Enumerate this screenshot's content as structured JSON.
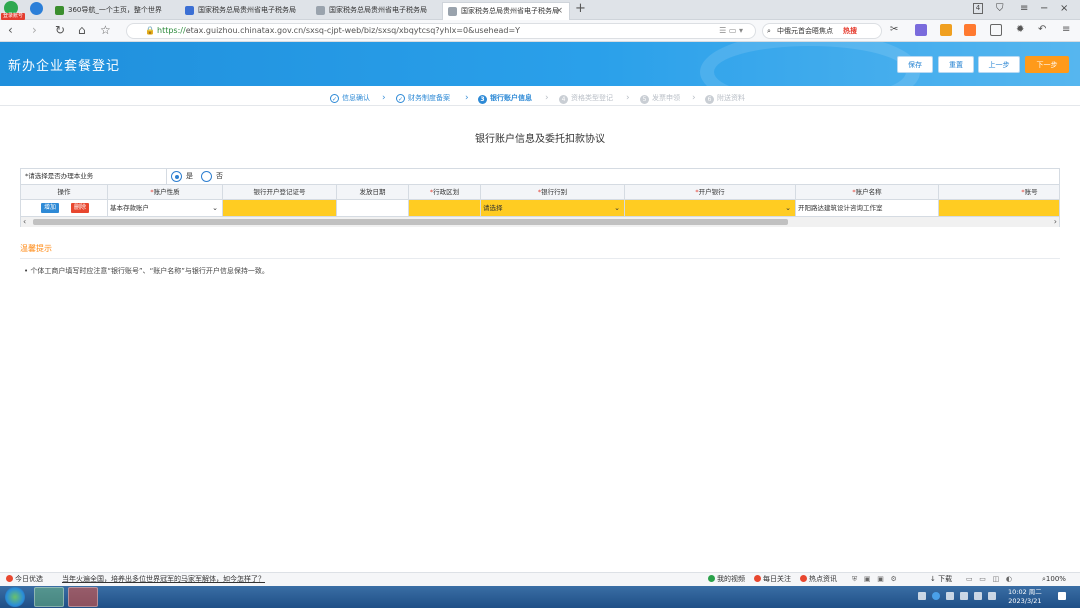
{
  "browser": {
    "badge": "登录账号",
    "tabs": [
      {
        "label": "360导航_一个主页，整个世界",
        "icon_color": "#3a8e2e"
      },
      {
        "label": "国家税务总局贵州省电子税务局",
        "icon_color": "#3b6fd4"
      },
      {
        "label": "国家税务总局贵州省电子税务局",
        "icon_color": "#9aa3ad"
      },
      {
        "label": "国家税务总局贵州省电子税务局",
        "icon_color": "#9aa3ad"
      }
    ],
    "tab_count": "4",
    "address": {
      "scheme": "https://",
      "host": "etax.guizhou.chinatax.gov.cn",
      "path": "/sxsq-cjpt-web/biz/sxsq/xbqytcsq?yhlx=0&usehead=Y"
    },
    "search": {
      "text": "中俄元首会晤焦点",
      "hot": "热搜"
    }
  },
  "app": {
    "title": "新办企业套餐登记",
    "buttons": {
      "save": "保存",
      "reset": "重置",
      "prev": "上一步",
      "next": "下一步"
    },
    "accent": "#2aa0ea",
    "next_color": "#ff9a1a"
  },
  "steps": [
    {
      "num": "✓",
      "label": "信息确认",
      "state": "done"
    },
    {
      "num": "✓",
      "label": "财务制度备案",
      "state": "done"
    },
    {
      "num": "3",
      "label": "银行账户信息",
      "state": "current"
    },
    {
      "num": "4",
      "label": "资格类型登记",
      "state": "todo"
    },
    {
      "num": "5",
      "label": "发票申领",
      "state": "todo"
    },
    {
      "num": "6",
      "label": "附送资料",
      "state": "todo"
    }
  ],
  "form": {
    "title": "银行账户信息及委托扣款协议",
    "question": {
      "label": "*请选择是否办理本业务",
      "options": [
        "是",
        "否"
      ],
      "selected": "是"
    },
    "columns": [
      {
        "req": "",
        "label": "操作"
      },
      {
        "req": "*",
        "label": "账户性质"
      },
      {
        "req": "",
        "label": "银行开户登记证号"
      },
      {
        "req": "",
        "label": "发放日期"
      },
      {
        "req": "*",
        "label": "行政区划"
      },
      {
        "req": "*",
        "label": "银行行别"
      },
      {
        "req": "*",
        "label": "开户银行"
      },
      {
        "req": "*",
        "label": "账户名称"
      },
      {
        "req": "*",
        "label": "账号"
      }
    ],
    "row": {
      "add": "增加",
      "delete": "删除",
      "account_type": "基本存款账户",
      "bank_reg_no": "",
      "issue_date": "",
      "district": "",
      "bank_type": "请选择",
      "bank": "",
      "account_name": "开阳路达建筑设计咨询工作室",
      "account_no": ""
    },
    "highlight": "#ffcc22"
  },
  "tips": {
    "title": "温馨提示",
    "items": [
      "• 个体工商户填写时应注意“银行账号”、“账户名称”与银行开户信息保持一致。"
    ]
  },
  "statusbar": {
    "left": "今日优选",
    "news": "当年火遍全国，培养出多位世界冠军的马家军解体，如今怎样了？",
    "items": [
      "我的视频",
      "每日关注",
      "热点资讯",
      "下载",
      "100%"
    ]
  },
  "taskbar": {
    "time": "10:02 周二",
    "date": "2023/3/21"
  }
}
